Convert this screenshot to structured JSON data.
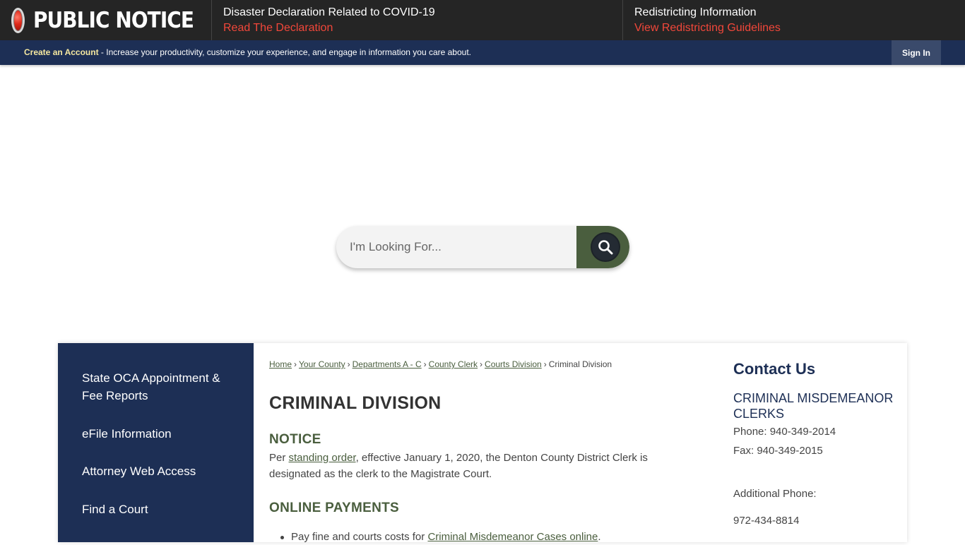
{
  "alert": {
    "brand": "PUBLIC NOTICE",
    "items": [
      {
        "heading": "Disaster Declaration Related to COVID-19",
        "link": "Read The Declaration"
      },
      {
        "heading": "Redistricting Information",
        "link": "View Redistricting Guidelines"
      }
    ]
  },
  "account": {
    "create_link": "Create an Account",
    "description": " - Increase your productivity, customize your experience, and engage in information you care about.",
    "sign_in": "Sign In"
  },
  "search": {
    "placeholder": "I'm Looking For..."
  },
  "side_nav": {
    "items": [
      "State OCA Appointment & Fee Reports",
      "eFile Information",
      "Attorney Web Access",
      "Find a Court"
    ]
  },
  "breadcrumb": {
    "links": [
      "Home",
      "Your County",
      "Departments A - C",
      "County Clerk",
      "Courts Division"
    ],
    "current": "Criminal Division",
    "separator": "›"
  },
  "main": {
    "title": "CRIMINAL DIVISION",
    "notice_heading": "NOTICE",
    "notice_prefix": "Per ",
    "notice_link": "standing order",
    "notice_suffix": ", effective January 1, 2020, the Denton County District Clerk is designated as the clerk to the Magistrate Court.",
    "payments_heading": "ONLINE PAYMENTS",
    "bullet_prefix": "Pay fine and courts costs for ",
    "bullet_link": "Criminal Misdemeanor Cases online",
    "bullet_suffix": "."
  },
  "contact": {
    "title": "Contact Us",
    "name": "CRIMINAL MISDEMEANOR CLERKS",
    "phone": "Phone: 940-349-2014",
    "fax": "Fax: 940-349-2015",
    "additional_label": "Additional Phone:",
    "additional_phone": "972-434-8814"
  },
  "colors": {
    "header_dark": "#252525",
    "navy": "#1d2f55",
    "alert_red": "#f2473a",
    "olive": "#4a5e3e"
  }
}
